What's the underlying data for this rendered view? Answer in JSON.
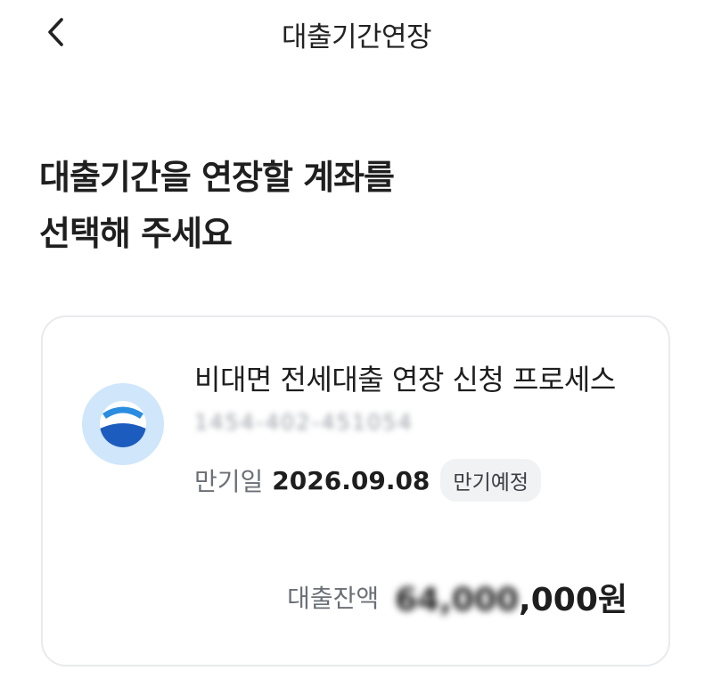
{
  "header": {
    "back_icon": "chevron-left-icon",
    "title": "대출기간연장"
  },
  "main": {
    "heading_line1": "대출기간을 연장할 계좌를",
    "heading_line2": "선택해 주세요"
  },
  "account": {
    "bank_logo": "bank-logo-icon",
    "product_name": "비대면 전세대출 연장 신청 프로세스",
    "account_number": "1454-402-451054",
    "maturity_label": "만기일",
    "maturity_date": "2026.09.08",
    "status_badge": "만기예정",
    "balance_label": "대출잔액",
    "balance_masked": "64,000",
    "balance_visible": ",000원"
  },
  "colors": {
    "logo_bg": "#cfe6fb",
    "logo_blue": "#1d5cbf",
    "card_border": "#e8eaed",
    "badge_bg": "#f1f2f4"
  }
}
